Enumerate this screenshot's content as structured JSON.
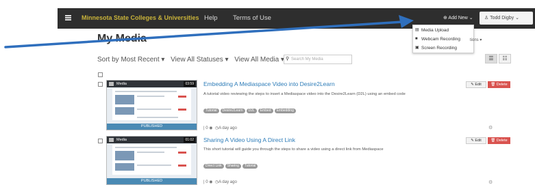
{
  "topbar": {
    "brand": "Minnesota State Colleges & Universities",
    "links": [
      "Help",
      "Terms of Use"
    ],
    "add_new": "⊕ Add New ⌄",
    "user": "Todd Digby ⌄"
  },
  "add_new_menu": {
    "items": [
      {
        "icon": "media-upload-icon",
        "label": "Media Upload"
      },
      {
        "icon": "webcam-icon",
        "label": "Webcam Recording"
      },
      {
        "icon": "screen-icon",
        "label": "Screen Recording"
      }
    ],
    "partially_hidden_button_suffix": "tions ▾"
  },
  "page": {
    "title": "My Media",
    "sort": "Sort by Most Recent ▾",
    "statuses": "View All Statuses ▾",
    "media_filter": "View All Media ▾",
    "search_placeholder": "Search My Media"
  },
  "entries": [
    {
      "title": "Embedding A Mediaspace Video into Desire2Learn",
      "description": "A tutorial video reviewing the steps to insert a Mediaspace video into the Desire2Learn (D2L) using an embed code",
      "tags": [
        "Tutorial",
        "Desire2Learn",
        "D2L",
        "Embed",
        "Embedding"
      ],
      "duration": "03:59",
      "thumb_header": "Media",
      "thumb_status": "PUBLISHED",
      "views": "0",
      "time": "A day ago",
      "edit_label": "✎ Edit",
      "delete_label": "🗑 Delete"
    },
    {
      "title": "Sharing A Video Using A Direct Link",
      "description": "This short tutorial will guide you through the steps to share a video using a direct link from Mediaspace",
      "tags": [
        "Direct Link",
        "Sharing",
        "Tutorial"
      ],
      "duration": "01:02",
      "thumb_header": "Media",
      "thumb_status": "PUBLISHED",
      "views": "0",
      "time": "A day ago",
      "edit_label": "✎ Edit",
      "delete_label": "🗑 Delete"
    }
  ],
  "colors": {
    "topbar": "#2e2e2e",
    "brand": "#c9b33a",
    "link": "#2d7cb8",
    "delete": "#d9534f",
    "annotation_arrow": "#2f6fbd"
  }
}
